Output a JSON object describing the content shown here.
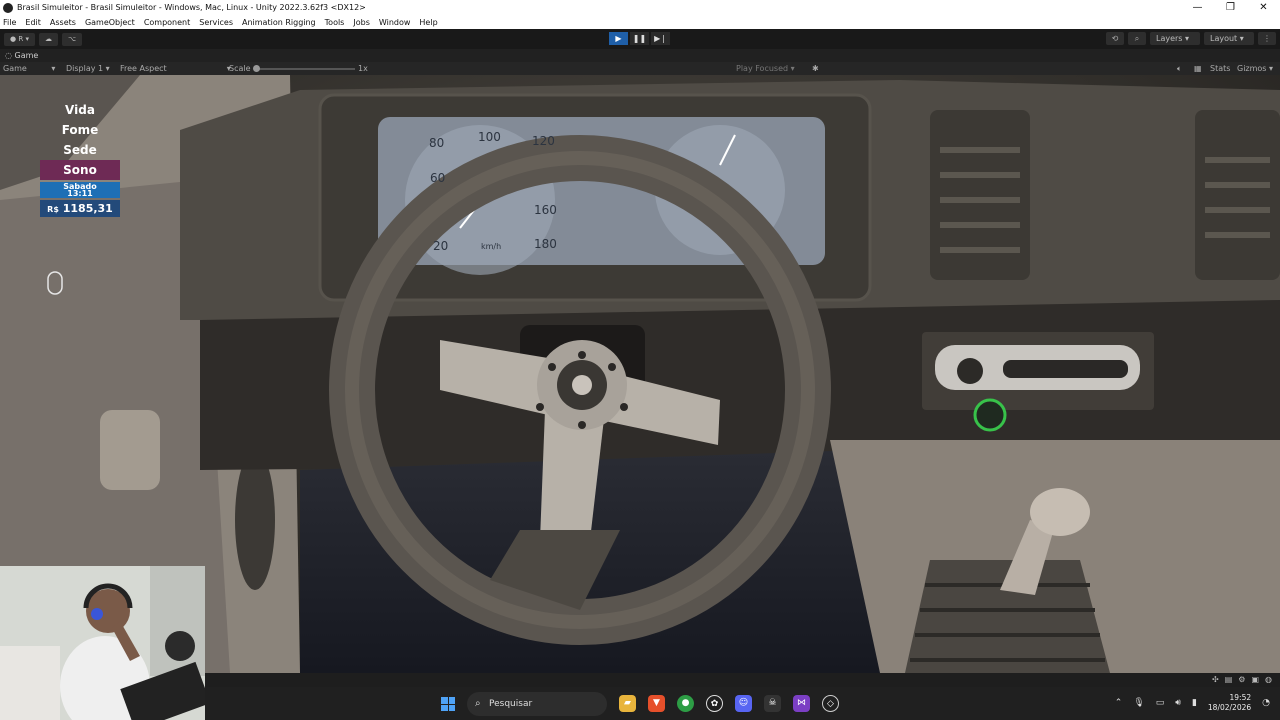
{
  "window": {
    "title": "Brasil Simuleitor - Brasil Simuleitor - Windows, Mac, Linux - Unity 2022.3.62f3 <DX12>",
    "controls": [
      "—",
      "❐",
      "✕"
    ]
  },
  "menu": [
    "File",
    "Edit",
    "Assets",
    "GameObject",
    "Component",
    "Services",
    "Animation Rigging",
    "Tools",
    "Jobs",
    "Window",
    "Help"
  ],
  "toolbar": {
    "account_label": "R",
    "layers_label": "Layers",
    "layout_label": "Layout"
  },
  "game_tab": {
    "label": "Game",
    "mode": "Game",
    "display": "Display 1",
    "aspect": "Free Aspect",
    "scale_label": "Scale",
    "scale_value": "1x",
    "play_focused": "Play Focused",
    "stats": "Stats",
    "gizmos": "Gizmos"
  },
  "hud": {
    "vida": "Vida",
    "fome": "Fome",
    "sede": "Sede",
    "sono": "Sono",
    "day": "Sabado",
    "time": "13:11",
    "currency": "R$",
    "money": "1185,31"
  },
  "dashboard": {
    "speed_ticks": [
      "20",
      "60",
      "80",
      "100",
      "120",
      "160",
      "180"
    ],
    "speed_unit": "km/h"
  },
  "taskbar": {
    "search_placeholder": "Pesquisar",
    "time": "19:52",
    "date": "18/02/2026"
  },
  "colors": {
    "play_active": "#1f5fa8",
    "sono_bar": "#6e2a55",
    "date_bar": "#1e6fb5",
    "money_bar": "#234a7a"
  }
}
